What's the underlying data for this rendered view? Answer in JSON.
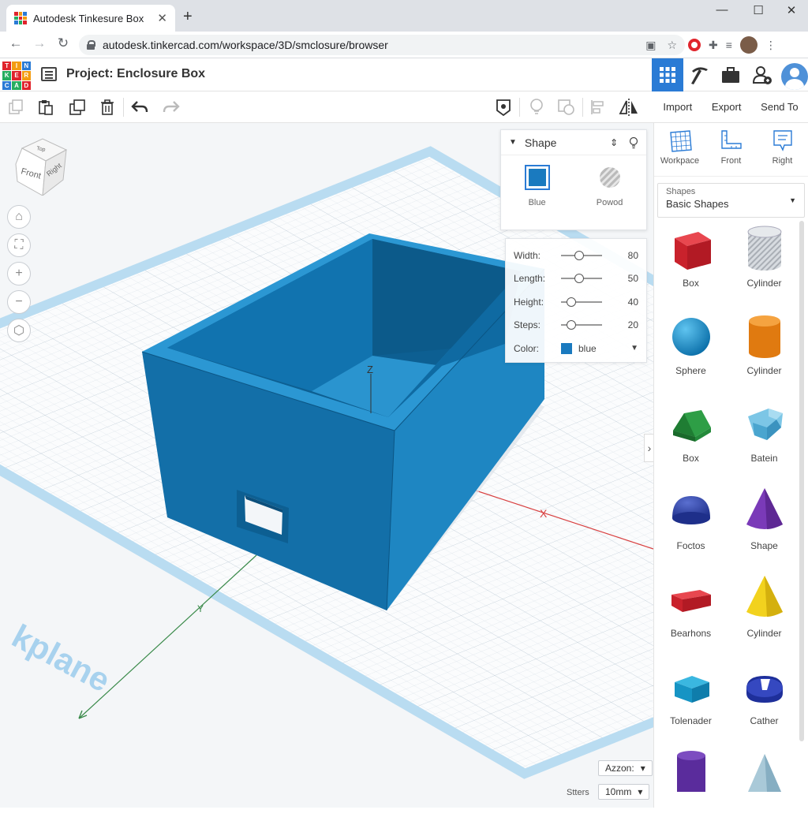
{
  "browser": {
    "tab_title": "Autodesk Tinkesure Box",
    "url": "autodesk.tinkercad.com/workspace/3D/smclosure/browser"
  },
  "app": {
    "logo_letters": [
      "T",
      "I",
      "N",
      "K",
      "E",
      "R",
      "C",
      "A",
      "D"
    ],
    "project_title": "Project: Enclosure Box"
  },
  "toolbar": {
    "import_label": "Import",
    "export_label": "Export",
    "sendto_label": "Send To"
  },
  "navcube": {
    "top": "Top",
    "front": "Front",
    "right": "Right"
  },
  "shape_panel": {
    "title": "Shape",
    "solid_label": "Blue",
    "hole_label": "Powod"
  },
  "properties": {
    "width_label": "Width:",
    "width_value": "80",
    "width_slider": 0.45,
    "length_label": "Length:",
    "length_value": "50",
    "length_slider": 0.45,
    "height_label": "Height:",
    "height_value": "40",
    "height_slider": 0.25,
    "steps_label": "Steps:",
    "steps_value": "20",
    "steps_slider": 0.25,
    "color_label": "Color:",
    "color_value": "blue",
    "color_hex": "#1a7abf"
  },
  "viewport": {
    "workplane_text": "kplane",
    "axis_z": "Z",
    "axis_x": "X",
    "axis_y": "Y",
    "snap_label": "Azzon:",
    "steps_label": "Stters",
    "steps_value": "10mm"
  },
  "views": {
    "workplace_label": "Workpace",
    "front_label": "Front",
    "right_label": "Right"
  },
  "library": {
    "category_label": "Shapes",
    "category_value": "Basic Shapes",
    "shapes": [
      {
        "label": "Box",
        "icon": "red-box-icon"
      },
      {
        "label": "Cylinder",
        "icon": "striped-cylinder-icon"
      },
      {
        "label": "Sphere",
        "icon": "blue-sphere-icon"
      },
      {
        "label": "Cylinder",
        "icon": "orange-cylinder-icon"
      },
      {
        "label": "Box",
        "icon": "green-roof-icon"
      },
      {
        "label": "Batein",
        "icon": "blue-torus-icon"
      },
      {
        "label": "Foctos",
        "icon": "navy-paraboloid-icon"
      },
      {
        "label": "Shape",
        "icon": "purple-cone-icon"
      },
      {
        "label": "Bearhons",
        "icon": "red-wedge-icon"
      },
      {
        "label": "Cylinder",
        "icon": "yellow-cone-icon"
      },
      {
        "label": "Tolenader",
        "icon": "teal-box-icon"
      },
      {
        "label": "Cather",
        "icon": "navy-ring-icon"
      }
    ]
  },
  "colors": {
    "accent": "#2a7bd5",
    "model": "#1a7abf",
    "grid_line": "#d3dde6"
  }
}
